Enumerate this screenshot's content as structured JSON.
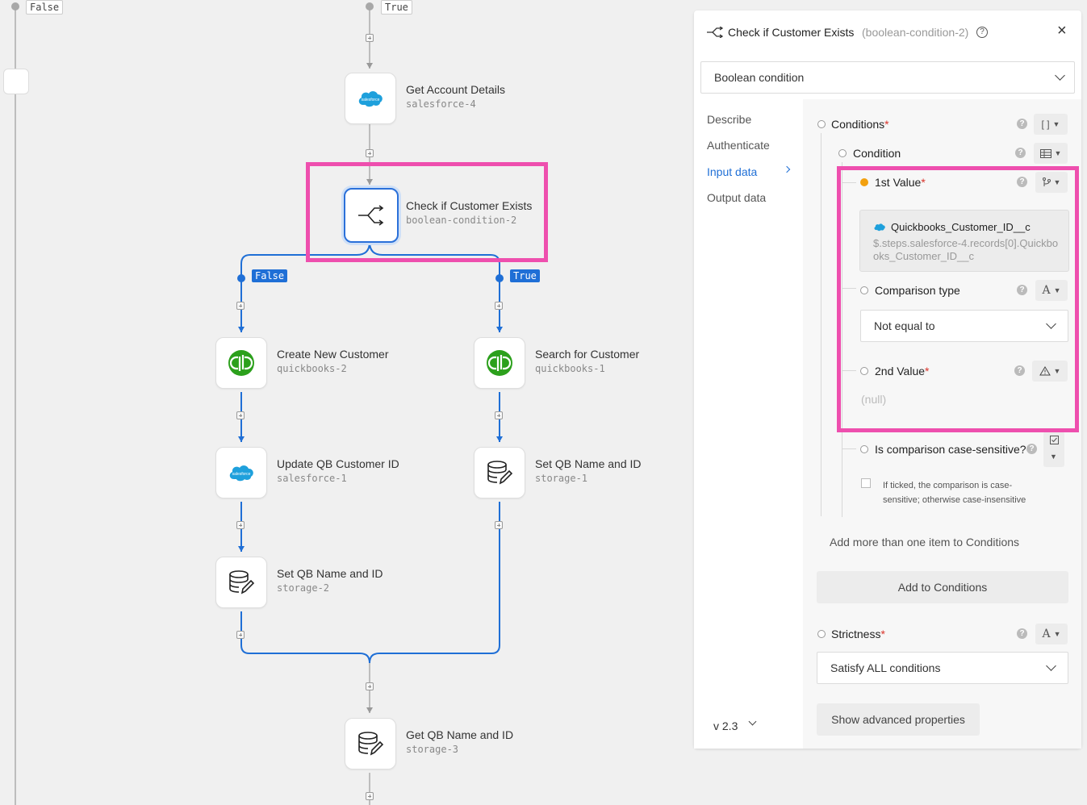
{
  "flow": {
    "top_branches": {
      "false_label": "False",
      "true_label": "True"
    },
    "nodes": [
      {
        "id": "get-account",
        "title": "Get Account Details",
        "sub": "salesforce-4",
        "icon": "salesforce-icon"
      },
      {
        "id": "check-exists",
        "title": "Check if Customer Exists",
        "sub": "boolean-condition-2",
        "icon": "branch-icon"
      },
      {
        "id": "create-customer",
        "title": "Create New Customer",
        "sub": "quickbooks-2",
        "icon": "quickbooks-icon"
      },
      {
        "id": "search-customer",
        "title": "Search for Customer",
        "sub": "quickbooks-1",
        "icon": "quickbooks-icon"
      },
      {
        "id": "update-qb-id",
        "title": "Update QB Customer ID",
        "sub": "salesforce-1",
        "icon": "salesforce-icon"
      },
      {
        "id": "set-qb-right",
        "title": "Set QB Name and ID",
        "sub": "storage-1",
        "icon": "storage-icon"
      },
      {
        "id": "set-qb-left",
        "title": "Set QB Name and ID",
        "sub": "storage-2",
        "icon": "storage-icon"
      },
      {
        "id": "get-qb",
        "title": "Get QB Name and ID",
        "sub": "storage-3",
        "icon": "storage-icon"
      }
    ],
    "branch_labels": {
      "false_label": "False",
      "true_label": "True"
    },
    "salesforce_logo_text": "salesforce"
  },
  "panel": {
    "title": "Check if Customer Exists",
    "subtitle": "(boolean-condition-2)",
    "help": "?",
    "close": "×",
    "operation": "Boolean condition",
    "nav": [
      "Describe",
      "Authenticate",
      "Input data",
      "Output data"
    ],
    "version": "v 2.3",
    "fields": {
      "conditions": {
        "label": "Conditions",
        "req": "*",
        "type": "[ ]"
      },
      "condition": {
        "label": "Condition"
      },
      "first_value": {
        "label": "1st Value",
        "req": "*",
        "ref_name": "Quickbooks_Customer_ID__c",
        "ref_path": "$.steps.salesforce-4.records[0].Quickbooks_Customer_ID__c"
      },
      "comparison_type": {
        "label": "Comparison type",
        "type": "A",
        "value": "Not equal to"
      },
      "second_value": {
        "label": "2nd Value",
        "req": "*",
        "value": "(null)"
      },
      "case_sensitive": {
        "label": "Is comparison case-sensitive?",
        "desc": "If ticked, the comparison is case-sensitive; otherwise case-insensitive"
      },
      "add_more_text": "Add more than one item to Conditions",
      "add_button": "Add to Conditions",
      "strictness": {
        "label": "Strictness",
        "req": "*",
        "type": "A",
        "value": "Satisfy ALL conditions"
      },
      "advanced_button": "Show advanced properties"
    }
  }
}
